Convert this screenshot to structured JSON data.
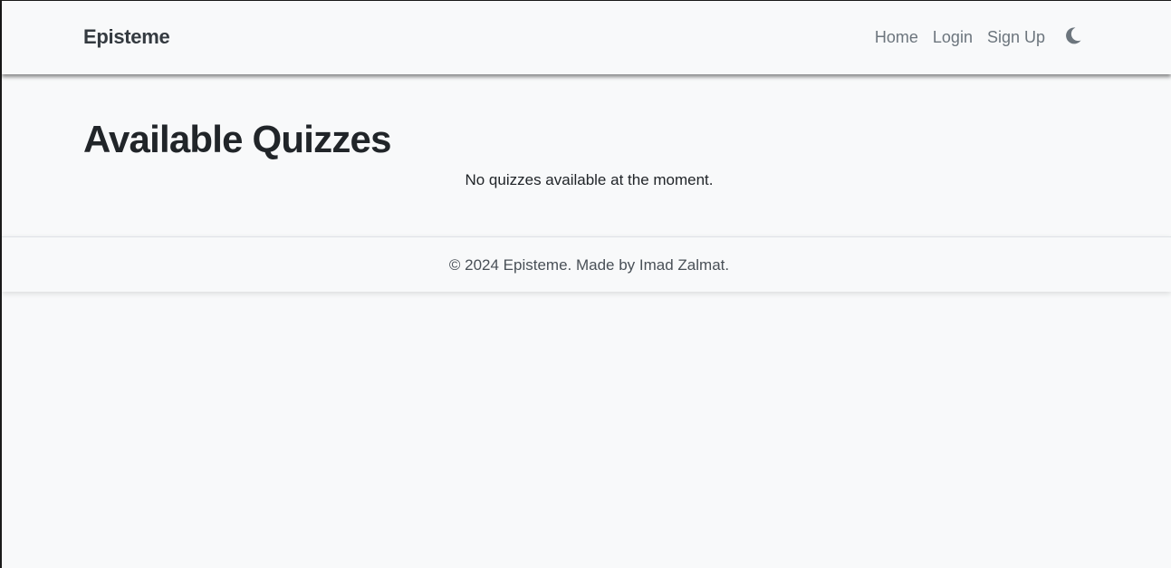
{
  "navbar": {
    "brand": "Episteme",
    "links": [
      {
        "label": "Home"
      },
      {
        "label": "Login"
      },
      {
        "label": "Sign Up"
      }
    ],
    "theme_toggle_icon": "moon-icon"
  },
  "main": {
    "title": "Available Quizzes",
    "empty_message": "No quizzes available at the moment."
  },
  "footer": {
    "text": "© 2024 Episteme. Made by Imad Zalmat."
  },
  "colors": {
    "background": "#f8f9fa",
    "text": "#212529",
    "nav_link": "#6c757d"
  }
}
